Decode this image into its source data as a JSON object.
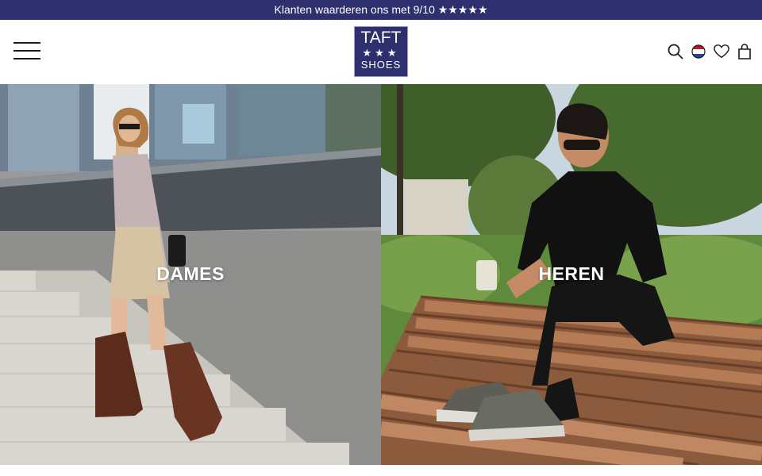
{
  "announcement": {
    "text": "Klanten waarderen ons met 9/10 ★★★★★"
  },
  "header": {
    "logo": {
      "line1": "TAFT",
      "line2": "★★★",
      "line3": "SHOES"
    },
    "icons": [
      "search-icon",
      "flag-nl-icon",
      "heart-icon",
      "bag-icon"
    ]
  },
  "hero": {
    "left": {
      "label": "DAMES"
    },
    "right": {
      "label": "HEREN"
    }
  },
  "colors": {
    "brand": "#2e2f6e",
    "text": "#1a1a1a",
    "white": "#ffffff"
  }
}
